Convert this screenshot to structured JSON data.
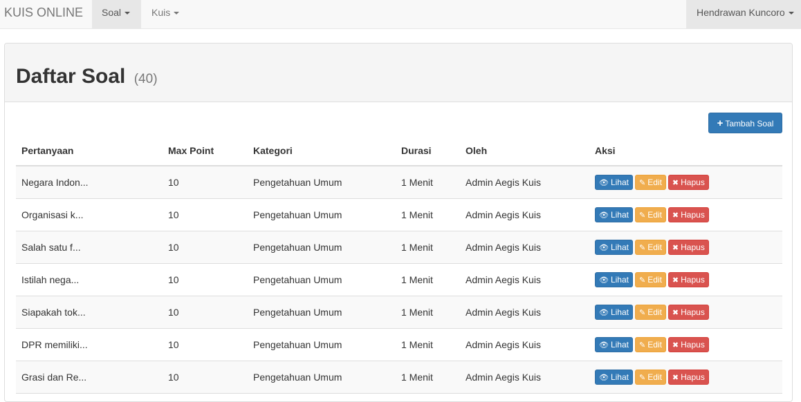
{
  "navbar": {
    "brand": "KUIS ONLINE",
    "menu": [
      {
        "label": "Soal",
        "active": true
      },
      {
        "label": "Kuis",
        "active": false
      }
    ],
    "user": "Hendrawan Kuncoro"
  },
  "panel": {
    "title": "Daftar Soal",
    "count": "(40)",
    "add_button": "Tambah Soal"
  },
  "table": {
    "headers": [
      "Pertanyaan",
      "Max Point",
      "Kategori",
      "Durasi",
      "Oleh",
      "Aksi"
    ],
    "actions": {
      "view": "Lihat",
      "edit": "Edit",
      "delete": "Hapus"
    },
    "rows": [
      {
        "pertanyaan": "Negara Indon...",
        "max_point": "10",
        "kategori": "Pengetahuan Umum",
        "durasi": "1 Menit",
        "oleh": "Admin Aegis Kuis"
      },
      {
        "pertanyaan": "Organisasi k...",
        "max_point": "10",
        "kategori": "Pengetahuan Umum",
        "durasi": "1 Menit",
        "oleh": "Admin Aegis Kuis"
      },
      {
        "pertanyaan": "Salah satu f...",
        "max_point": "10",
        "kategori": "Pengetahuan Umum",
        "durasi": "1 Menit",
        "oleh": "Admin Aegis Kuis"
      },
      {
        "pertanyaan": "Istilah nega...",
        "max_point": "10",
        "kategori": "Pengetahuan Umum",
        "durasi": "1 Menit",
        "oleh": "Admin Aegis Kuis"
      },
      {
        "pertanyaan": "Siapakah tok...",
        "max_point": "10",
        "kategori": "Pengetahuan Umum",
        "durasi": "1 Menit",
        "oleh": "Admin Aegis Kuis"
      },
      {
        "pertanyaan": "DPR memiliki...",
        "max_point": "10",
        "kategori": "Pengetahuan Umum",
        "durasi": "1 Menit",
        "oleh": "Admin Aegis Kuis"
      },
      {
        "pertanyaan": "Grasi dan Re...",
        "max_point": "10",
        "kategori": "Pengetahuan Umum",
        "durasi": "1 Menit",
        "oleh": "Admin Aegis Kuis"
      }
    ]
  },
  "colors": {
    "primary": "#337ab7",
    "warning": "#f0ad4e",
    "danger": "#d9534f"
  },
  "icons": {
    "add": "plus-icon",
    "view": "eye-icon",
    "edit": "pencil-icon",
    "delete": "times-icon"
  }
}
